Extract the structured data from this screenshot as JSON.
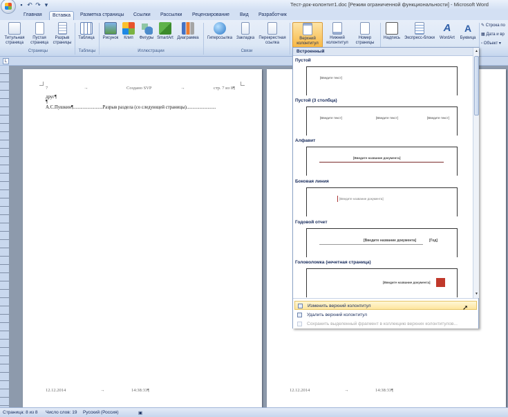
{
  "window": {
    "title": "Тест-док-колонтит1.doc [Режим ограниченной функциональности] - Microsoft Word"
  },
  "tabs": [
    {
      "label": "Главная",
      "active": false
    },
    {
      "label": "Вставка",
      "active": true
    },
    {
      "label": "Разметка страницы",
      "active": false
    },
    {
      "label": "Ссылки",
      "active": false
    },
    {
      "label": "Рассылки",
      "active": false
    },
    {
      "label": "Рецензирование",
      "active": false
    },
    {
      "label": "Вид",
      "active": false
    },
    {
      "label": "Разработчик",
      "active": false
    }
  ],
  "ribbon": {
    "buttons": {
      "title_page": "Титульная страница",
      "blank_page": "Пустая страница",
      "page_break": "Разрыв страницы",
      "table": "Таблица",
      "picture": "Рисунок",
      "clip": "Клип",
      "shapes": "Фигуры",
      "smartart": "SmartArt",
      "chart": "Диаграмма",
      "hyperlink": "Гиперссылка",
      "bookmark": "Закладка",
      "cross_ref": "Перекрестная ссылка",
      "header": "Верхний колонтитул",
      "footer": "Нижний колонтитул",
      "page_number": "Номер страницы",
      "textbox": "Надпись",
      "quick_parts": "Экспресс-блоки",
      "wordart": "WordArt",
      "dropcap": "Буквица"
    },
    "small_items": {
      "signature_line": "Строка по",
      "date_time": "Дата и вр",
      "object": "Объект"
    },
    "groups": {
      "pages": "Страницы",
      "tables": "Таблицы",
      "illustrations": "Иллюстрации",
      "links": "Связи"
    }
  },
  "document": {
    "page1": {
      "header_left": "7",
      "header_center": "Создано SVP",
      "header_right": "стр. 7 из 8¶",
      "line1": "друг¶",
      "line2": "¶",
      "line3": "А.С.Пушкин¶.........................Разрыв раздела (со следующей страницы).........................",
      "footer_left": "12.12.2014",
      "footer_right": "14:38:33¶",
      "tab_arrow": "→"
    },
    "page2": {
      "footer_left": "12.12.2014",
      "footer_right": "14:38:33¶"
    }
  },
  "gallery": {
    "builtin_label": "Встроенный",
    "sections": [
      {
        "name": "Пустой",
        "placeholders": [
          "[Введите текст]"
        ]
      },
      {
        "name": "Пустой (3 столбца)",
        "placeholders": [
          "[Введите текст]",
          "[Введите текст]",
          "[Введите текст]"
        ]
      },
      {
        "name": "Алфавит",
        "placeholders": [
          "[Введите название документа]"
        ]
      },
      {
        "name": "Боковая линия",
        "placeholders": [
          "[Введите название документа]"
        ]
      },
      {
        "name": "Годовой отчет",
        "placeholders": [
          "[Введите название документа]",
          "[Год]"
        ]
      },
      {
        "name": "Головоломка (нечетная страница)",
        "placeholders": [
          "[Введите название документа]"
        ]
      }
    ],
    "menu": {
      "edit_header": "Изменить верхний колонтитул",
      "remove_header": "Удалить верхний колонтитул",
      "save_selection": "Сохранить выделенный фрагмент в коллекцию верхних колонтитулов..."
    }
  },
  "status": {
    "page": "Страница: 8 из 8",
    "words": "Число слов: 19",
    "language": "Русский (Россия)"
  },
  "colors": {
    "accent_active": "#f8b844",
    "ribbon_bg": "#dce7f5",
    "workspace_bg": "#8d9aac"
  }
}
